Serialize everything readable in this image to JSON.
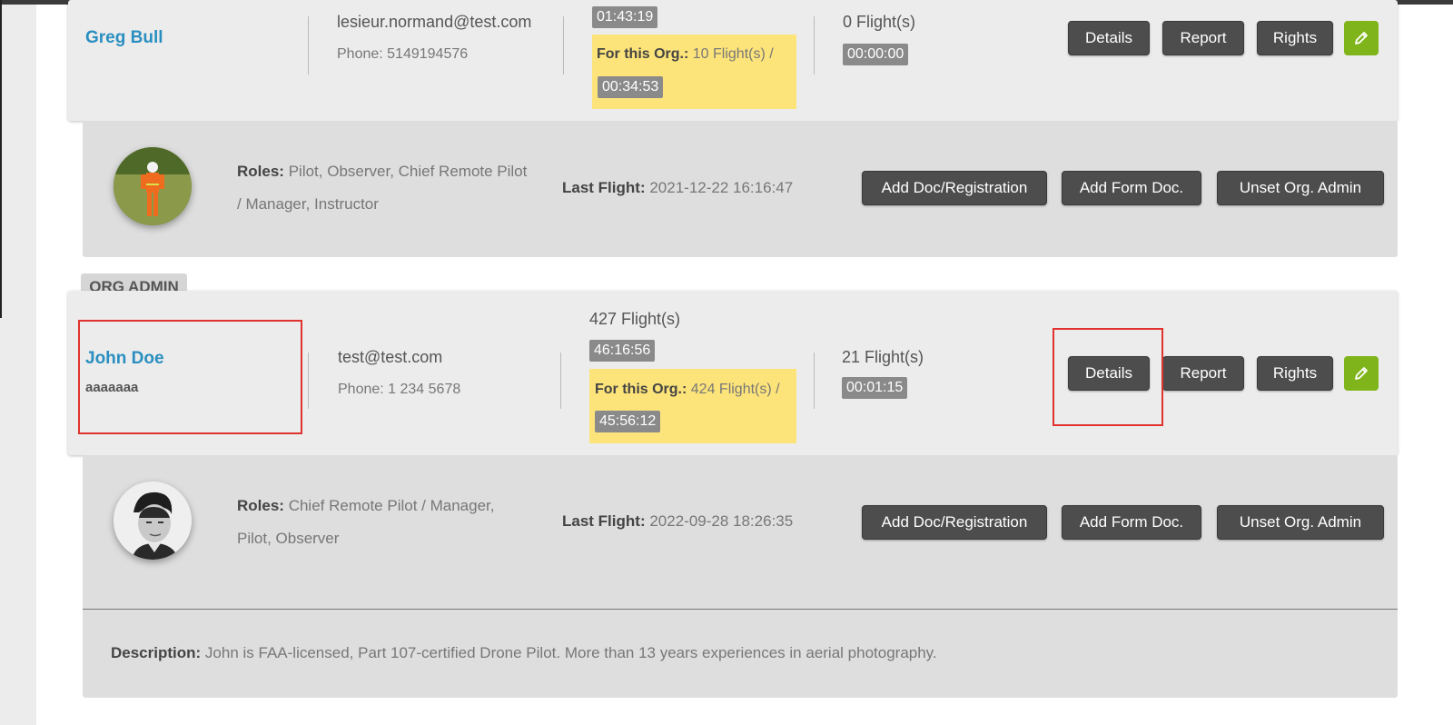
{
  "badge": "ORG ADMIN",
  "users": [
    {
      "name": "Greg Bull",
      "subname": "",
      "email": "lesieur.normand@test.com",
      "phone": "Phone: 5149194576",
      "total_flights": "",
      "total_time": "01:43:19",
      "org_label": "For this Org.:",
      "org_flights": "10 Flight(s) /",
      "org_time": "00:34:53",
      "flights": "0 Flight(s)",
      "flights_time": "00:00:00",
      "roles_label": "Roles:",
      "roles_line1": "Pilot, Observer, Chief Remote Pilot",
      "roles_line2": "/ Manager, Instructor",
      "last_flight_label": "Last Flight:",
      "last_flight": "2021-12-22 16:16:47"
    },
    {
      "name": "John Doe",
      "subname": "aaaaaaa",
      "email": "test@test.com",
      "phone": "Phone: 1 234 5678",
      "total_flights": "427 Flight(s)",
      "total_time": "46:16:56",
      "org_label": "For this Org.:",
      "org_flights": "424 Flight(s) /",
      "org_time": "45:56:12",
      "flights": "21 Flight(s)",
      "flights_time": "00:01:15",
      "roles_label": "Roles:",
      "roles_line1": "Chief Remote Pilot / Manager,",
      "roles_line2": "Pilot, Observer",
      "last_flight_label": "Last Flight:",
      "last_flight": "2022-09-28 18:26:35",
      "description_label": "Description:",
      "description": "John is FAA-licensed, Part 107-certified Drone Pilot. More than 13 years experiences in aerial photography."
    }
  ],
  "buttons": {
    "details": "Details",
    "report": "Report",
    "rights": "Rights",
    "add_doc": "Add Doc/Registration",
    "add_form": "Add Form Doc.",
    "unset_admin": "Unset Org. Admin"
  },
  "icons": {
    "edit": "pencil-icon",
    "edit_color": "#7fb51a"
  }
}
